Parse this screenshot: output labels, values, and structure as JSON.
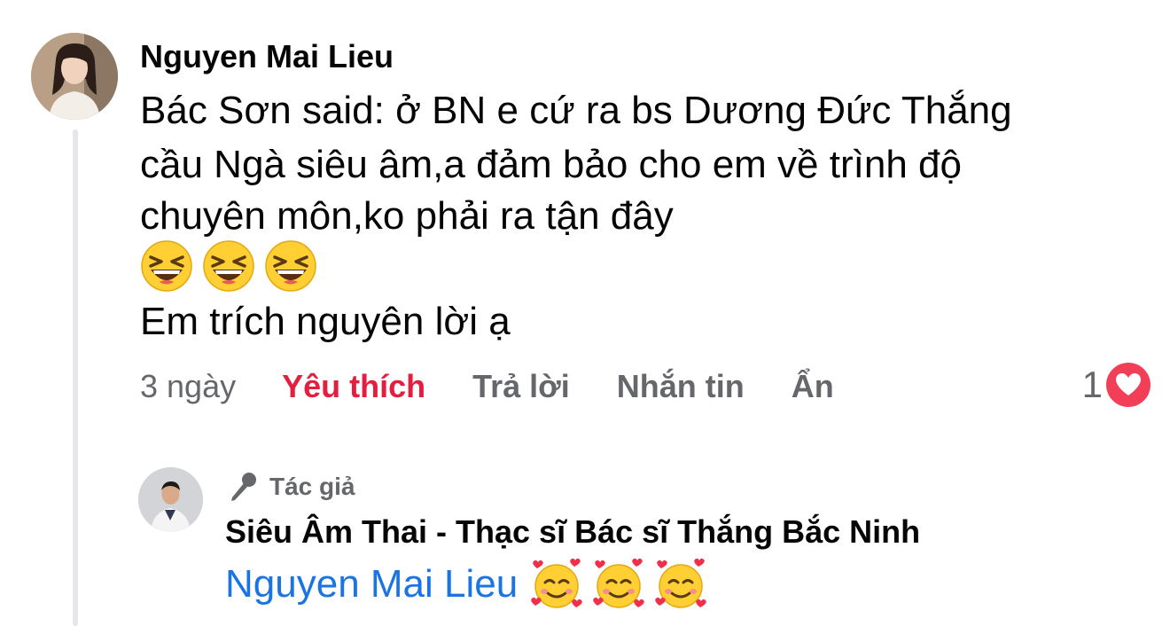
{
  "comment": {
    "author": "Nguyen Mai Lieu",
    "lines": [
      "Bác Sơn said: ở BN e cứ ra bs Dương Đức Thắng",
      "cầu Ngà siêu âm,a đảm bảo cho em về trình độ",
      "chuyên môn,ko phải ra tận đây"
    ],
    "emojis": [
      "grinning-squinting-face",
      "grinning-squinting-face",
      "grinning-squinting-face"
    ],
    "last_line": "Em trích nguyên lời ạ",
    "time": "3 ngày",
    "actions": {
      "like": "Yêu thích",
      "reply": "Trả lời",
      "message": "Nhắn tin",
      "hide": "Ẩn"
    },
    "reaction_count": "1",
    "reaction_icon": "heart-icon",
    "like_color": "#e41e3f"
  },
  "reply": {
    "badge_label": "Tác giả",
    "badge_icon": "microphone-icon",
    "author": "Siêu Âm Thai - Thạc sĩ Bác sĩ Thắng Bắc Ninh",
    "mention": "Nguyen Mai Lieu",
    "mention_color": "#1b74e4",
    "emojis": [
      "smiling-face-with-hearts",
      "smiling-face-with-hearts",
      "smiling-face-with-hearts"
    ]
  }
}
